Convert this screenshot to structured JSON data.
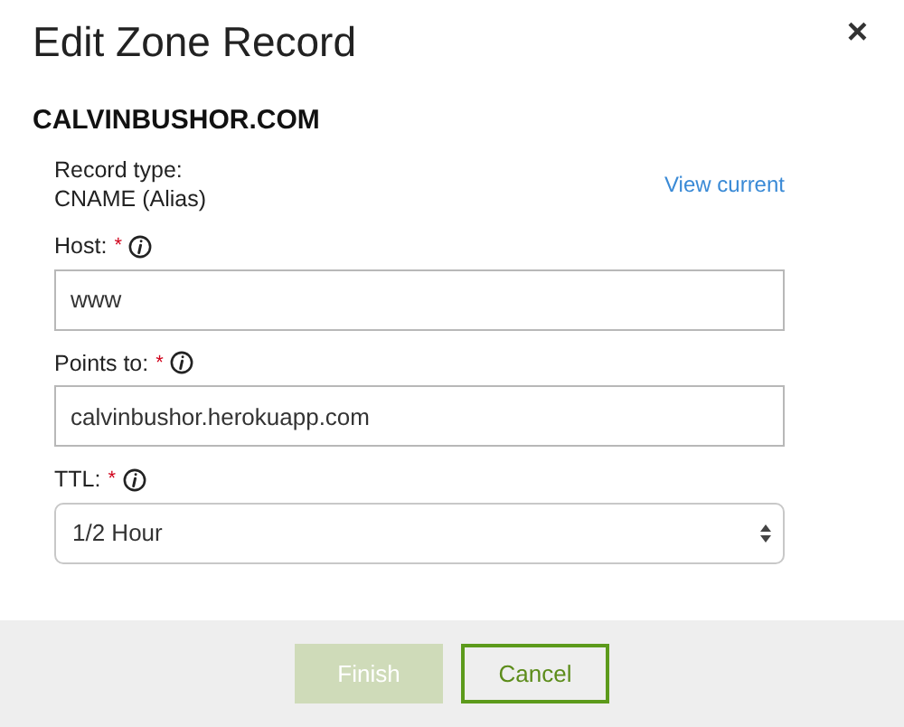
{
  "dialog": {
    "title": "Edit Zone Record",
    "close": "×"
  },
  "domain": "CALVINBUSHOR.COM",
  "record_type": {
    "label": "Record type:",
    "value": "CNAME (Alias)",
    "link": "View current"
  },
  "fields": [
    {
      "kind": "input",
      "label": "Host:",
      "required_mark": "*",
      "value": "www"
    },
    {
      "kind": "input",
      "label": "Points to:",
      "required_mark": "*",
      "value": "calvinbushor.herokuapp.com"
    },
    {
      "kind": "select",
      "label": "TTL:",
      "required_mark": "*",
      "value": "1/2 Hour"
    }
  ],
  "buttons": [
    {
      "kind": "primary",
      "label": "Finish",
      "disabled": true
    },
    {
      "kind": "outline",
      "label": "Cancel",
      "disabled": false
    }
  ]
}
